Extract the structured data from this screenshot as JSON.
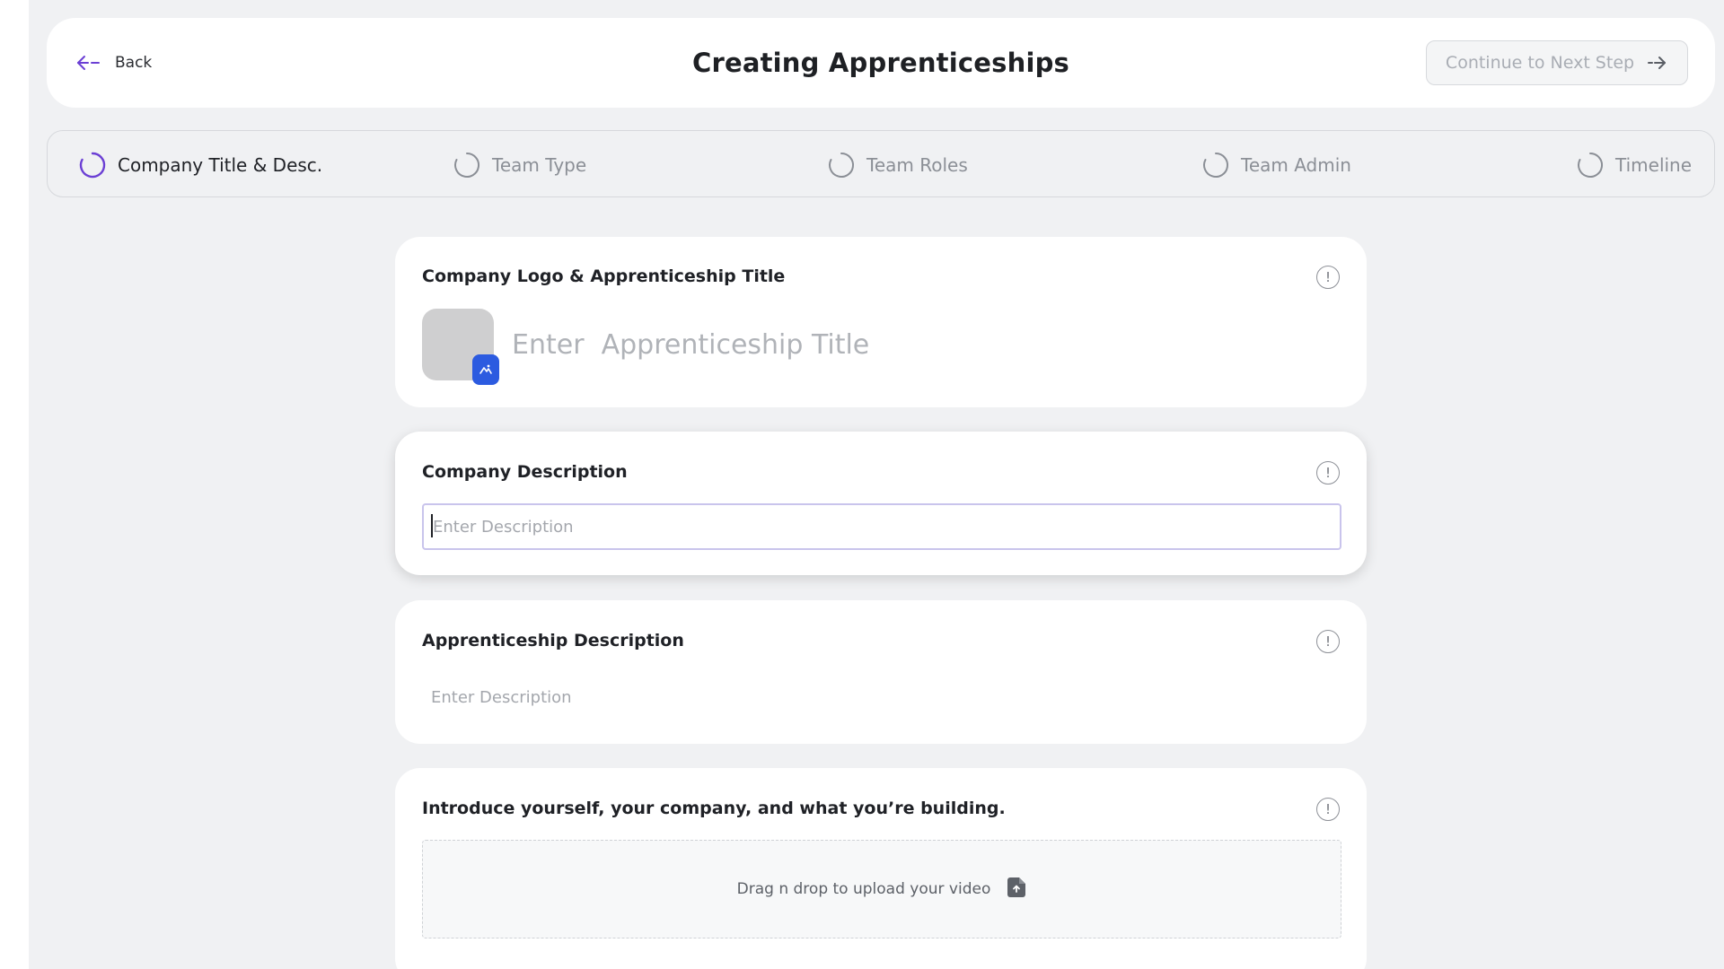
{
  "header": {
    "back_label": "Back",
    "title": "Creating Apprenticeships",
    "next_label": "Continue to Next Step"
  },
  "steps": [
    {
      "label": "Company Title & Desc.",
      "active": true
    },
    {
      "label": "Team Type",
      "active": false
    },
    {
      "label": "Team Roles",
      "active": false
    },
    {
      "label": "Team Admin",
      "active": false
    },
    {
      "label": "Timeline",
      "active": false
    }
  ],
  "cards": {
    "logo_title": {
      "title": "Company Logo & Apprenticeship Title",
      "placeholder": "Enter  Apprenticeship Title"
    },
    "company_description": {
      "title": "Company Description",
      "placeholder": "Enter Description"
    },
    "apprenticeship_description": {
      "title": "Apprenticeship Description",
      "placeholder": "Enter Description"
    },
    "intro_video": {
      "title": "Introduce yourself, your company, and what you’re building.",
      "dropzone_label": "Drag n drop to upload your video"
    }
  },
  "icons": {
    "back": "arrow-left-icon",
    "next": "arrow-right-icon",
    "info": "info-icon",
    "step": "progress-spinner-icon",
    "logo_edit": "image-edit-icon",
    "upload": "file-upload-icon"
  },
  "colors": {
    "accent": "#6b3fd4",
    "badge": "#2c5be0",
    "background": "#f0f1f3",
    "card": "#ffffff"
  }
}
